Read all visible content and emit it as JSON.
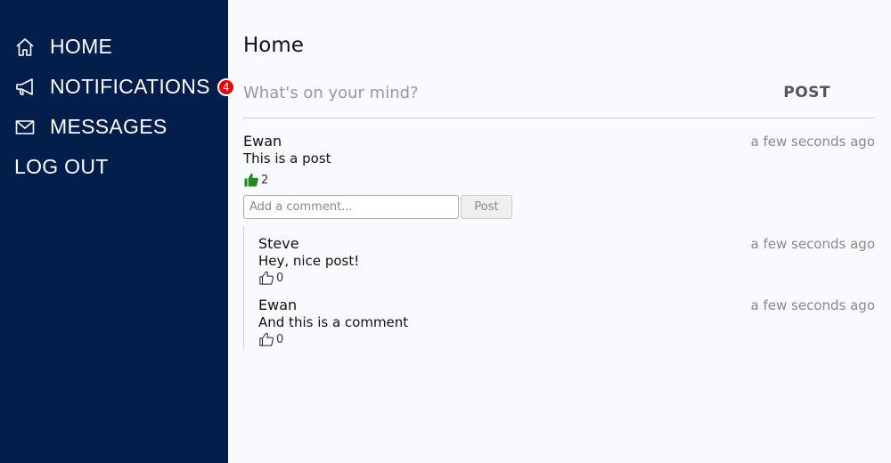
{
  "sidebar": {
    "items": [
      {
        "label": "HOME",
        "icon": "home-icon"
      },
      {
        "label": "NOTIFICATIONS",
        "icon": "megaphone-icon",
        "badge": "4"
      },
      {
        "label": "MESSAGES",
        "icon": "envelope-icon"
      },
      {
        "label": "LOG OUT"
      }
    ]
  },
  "main": {
    "title": "Home",
    "composer": {
      "placeholder": "What's on your mind?",
      "post_label": "POST"
    },
    "post": {
      "author": "Ewan",
      "time": "a few seconds ago",
      "text": "This is a post",
      "likes": "2",
      "liked": true,
      "comment_placeholder": "Add a comment...",
      "comment_post_label": "Post",
      "comments": [
        {
          "author": "Steve",
          "time": "a few seconds ago",
          "text": "Hey, nice post!",
          "likes": "0"
        },
        {
          "author": "Ewan",
          "time": "a few seconds ago",
          "text": "And this is a comment",
          "likes": "0"
        }
      ]
    }
  },
  "colors": {
    "sidebar_bg": "#041e4c",
    "badge": "#ee0000",
    "liked": "#1f8a1f"
  }
}
